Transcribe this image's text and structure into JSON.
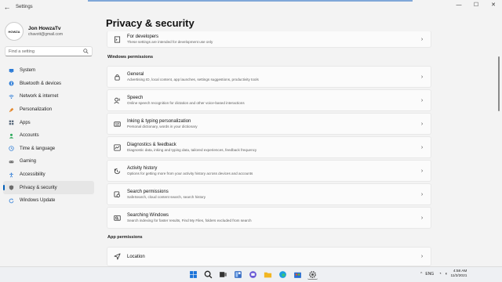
{
  "window": {
    "title": "Settings",
    "back_glyph": "←",
    "min_glyph": "—",
    "max_glyph": "☐",
    "close_glyph": "✕"
  },
  "profile": {
    "name": "Jon HowzaTv",
    "email": "chavott@gmail.com",
    "avatar_text": "HOWZA"
  },
  "search": {
    "placeholder": "Find a setting"
  },
  "nav": [
    {
      "label": "System",
      "icon": "monitor-icon",
      "color": "#2b7bd6"
    },
    {
      "label": "Bluetooth & devices",
      "icon": "bluetooth-icon",
      "color": "#2b7bd6"
    },
    {
      "label": "Network & internet",
      "icon": "wifi-icon",
      "color": "#2b7bd6"
    },
    {
      "label": "Personalization",
      "icon": "brush-icon",
      "color": "#e3872b"
    },
    {
      "label": "Apps",
      "icon": "apps-icon",
      "color": "#5b6b7d"
    },
    {
      "label": "Accounts",
      "icon": "person-icon",
      "color": "#2eaa5c"
    },
    {
      "label": "Time & language",
      "icon": "globe-clock-icon",
      "color": "#2b7bd6"
    },
    {
      "label": "Gaming",
      "icon": "controller-icon",
      "color": "#6b6b6b"
    },
    {
      "label": "Accessibility",
      "icon": "accessibility-icon",
      "color": "#2b7bd6"
    },
    {
      "label": "Privacy & security",
      "icon": "shield-icon",
      "color": "#6b6b6b",
      "active": true
    },
    {
      "label": "Windows Update",
      "icon": "update-icon",
      "color": "#2b7bd6"
    }
  ],
  "page": {
    "title": "Privacy & security"
  },
  "cards_top": [
    {
      "title": "For developers",
      "desc": "These settings are intended for development use only",
      "icon": "developer-tools-icon"
    }
  ],
  "sections": {
    "windows_permissions": "Windows permissions",
    "app_permissions": "App permissions"
  },
  "cards": [
    {
      "title": "General",
      "desc": "Advertising ID, local content, app launches, settings suggestions, productivity tools",
      "icon": "lock-icon"
    },
    {
      "title": "Speech",
      "desc": "Online speech recognition for dictation and other voice-based interactions",
      "icon": "speech-icon"
    },
    {
      "title": "Inking & typing personalization",
      "desc": "Personal dictionary, words in your dictionary",
      "icon": "inking-icon"
    },
    {
      "title": "Diagnostics & feedback",
      "desc": "Diagnostic data, inking and typing data, tailored experiences, feedback frequency",
      "icon": "diagnostics-icon"
    },
    {
      "title": "Activity history",
      "desc": "Options for getting more from your activity history across devices and accounts",
      "icon": "history-icon"
    },
    {
      "title": "Search permissions",
      "desc": "SafeSearch, cloud content search, search history",
      "icon": "search-permissions-icon"
    },
    {
      "title": "Searching Windows",
      "desc": "Search indexing for faster results, Find My Files, folders excluded from search",
      "icon": "searching-windows-icon"
    }
  ],
  "app_cards": [
    {
      "title": "Location",
      "desc": "",
      "icon": "location-icon"
    }
  ],
  "chevron": "›",
  "taskbar": {
    "apps": [
      "windows-start-icon",
      "search-icon",
      "task-view-icon",
      "widgets-icon",
      "chat-icon",
      "file-explorer-icon",
      "edge-icon",
      "store-icon",
      "settings-icon"
    ],
    "tray_arrow": "^",
    "language": "ENG",
    "wifi_glyph": "◔",
    "volume_glyph": "◖",
    "time": "4:58 AM",
    "date": "11/2/2021"
  },
  "colors": {
    "accent": "#005fb8",
    "background": "#f3f3f3",
    "card": "#fbfbfb"
  }
}
